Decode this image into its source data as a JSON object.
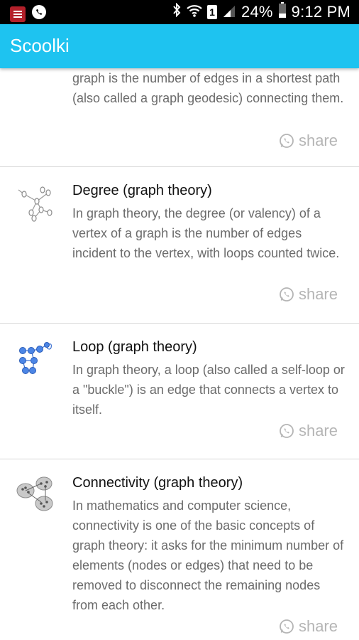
{
  "status_bar": {
    "battery": "24%",
    "time": "9:12 PM",
    "sim_number": "1",
    "icons": [
      "news-app-icon",
      "whatsapp-status-icon",
      "bluetooth-icon",
      "wifi-icon",
      "sim-icon",
      "signal-icon",
      "battery-icon"
    ]
  },
  "app": {
    "title": "Scoolki"
  },
  "articles": [
    {
      "title": "",
      "description": "graph is the number of edges in a shortest path (also called a graph geodesic) connecting them.",
      "share_label": "share"
    },
    {
      "title": "Degree (graph theory)",
      "description": "In graph theory, the degree (or valency) of a vertex of a graph is the number of edges incident to the vertex, with loops counted twice.",
      "share_label": "share",
      "icon": "degree-graph-thumbnail"
    },
    {
      "title": "Loop (graph theory)",
      "description": "In graph theory, a loop (also called a self-loop or a \"buckle\") is an edge that connects a vertex to itself.",
      "share_label": "share",
      "icon": "loop-graph-thumbnail"
    },
    {
      "title": "Connectivity (graph theory)",
      "description": "In mathematics and computer science, connectivity is one of the basic concepts of graph theory: it asks for the minimum number of elements (nodes or edges) that need to be removed to disconnect the remaining nodes from each other.",
      "share_label": "share",
      "icon": "connectivity-graph-thumbnail"
    }
  ],
  "colors": {
    "app_bar": "#1ec3f0",
    "status_bar": "#000000",
    "title_text": "#111111",
    "body_text": "#6b6b6b",
    "share_text": "#b5b5b5",
    "divider": "#d8d8d8"
  }
}
